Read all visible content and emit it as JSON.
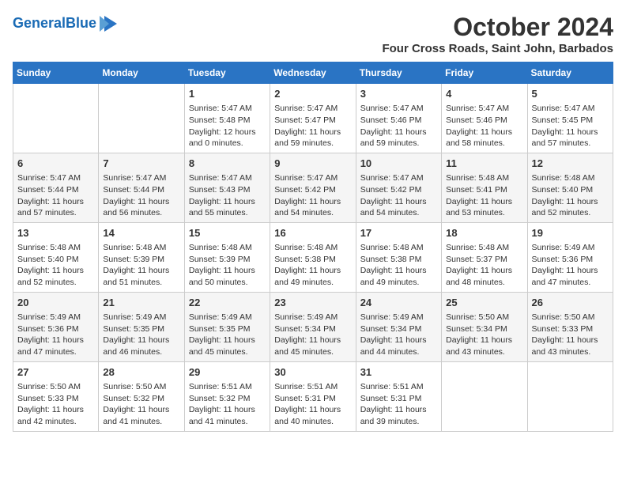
{
  "logo": {
    "text_general": "General",
    "text_blue": "Blue"
  },
  "header": {
    "month": "October 2024",
    "location": "Four Cross Roads, Saint John, Barbados"
  },
  "days_of_week": [
    "Sunday",
    "Monday",
    "Tuesday",
    "Wednesday",
    "Thursday",
    "Friday",
    "Saturday"
  ],
  "weeks": [
    [
      {
        "day": "",
        "content": ""
      },
      {
        "day": "",
        "content": ""
      },
      {
        "day": "1",
        "content": "Sunrise: 5:47 AM\nSunset: 5:48 PM\nDaylight: 12 hours and 0 minutes."
      },
      {
        "day": "2",
        "content": "Sunrise: 5:47 AM\nSunset: 5:47 PM\nDaylight: 11 hours and 59 minutes."
      },
      {
        "day": "3",
        "content": "Sunrise: 5:47 AM\nSunset: 5:46 PM\nDaylight: 11 hours and 59 minutes."
      },
      {
        "day": "4",
        "content": "Sunrise: 5:47 AM\nSunset: 5:46 PM\nDaylight: 11 hours and 58 minutes."
      },
      {
        "day": "5",
        "content": "Sunrise: 5:47 AM\nSunset: 5:45 PM\nDaylight: 11 hours and 57 minutes."
      }
    ],
    [
      {
        "day": "6",
        "content": "Sunrise: 5:47 AM\nSunset: 5:44 PM\nDaylight: 11 hours and 57 minutes."
      },
      {
        "day": "7",
        "content": "Sunrise: 5:47 AM\nSunset: 5:44 PM\nDaylight: 11 hours and 56 minutes."
      },
      {
        "day": "8",
        "content": "Sunrise: 5:47 AM\nSunset: 5:43 PM\nDaylight: 11 hours and 55 minutes."
      },
      {
        "day": "9",
        "content": "Sunrise: 5:47 AM\nSunset: 5:42 PM\nDaylight: 11 hours and 54 minutes."
      },
      {
        "day": "10",
        "content": "Sunrise: 5:47 AM\nSunset: 5:42 PM\nDaylight: 11 hours and 54 minutes."
      },
      {
        "day": "11",
        "content": "Sunrise: 5:48 AM\nSunset: 5:41 PM\nDaylight: 11 hours and 53 minutes."
      },
      {
        "day": "12",
        "content": "Sunrise: 5:48 AM\nSunset: 5:40 PM\nDaylight: 11 hours and 52 minutes."
      }
    ],
    [
      {
        "day": "13",
        "content": "Sunrise: 5:48 AM\nSunset: 5:40 PM\nDaylight: 11 hours and 52 minutes."
      },
      {
        "day": "14",
        "content": "Sunrise: 5:48 AM\nSunset: 5:39 PM\nDaylight: 11 hours and 51 minutes."
      },
      {
        "day": "15",
        "content": "Sunrise: 5:48 AM\nSunset: 5:39 PM\nDaylight: 11 hours and 50 minutes."
      },
      {
        "day": "16",
        "content": "Sunrise: 5:48 AM\nSunset: 5:38 PM\nDaylight: 11 hours and 49 minutes."
      },
      {
        "day": "17",
        "content": "Sunrise: 5:48 AM\nSunset: 5:38 PM\nDaylight: 11 hours and 49 minutes."
      },
      {
        "day": "18",
        "content": "Sunrise: 5:48 AM\nSunset: 5:37 PM\nDaylight: 11 hours and 48 minutes."
      },
      {
        "day": "19",
        "content": "Sunrise: 5:49 AM\nSunset: 5:36 PM\nDaylight: 11 hours and 47 minutes."
      }
    ],
    [
      {
        "day": "20",
        "content": "Sunrise: 5:49 AM\nSunset: 5:36 PM\nDaylight: 11 hours and 47 minutes."
      },
      {
        "day": "21",
        "content": "Sunrise: 5:49 AM\nSunset: 5:35 PM\nDaylight: 11 hours and 46 minutes."
      },
      {
        "day": "22",
        "content": "Sunrise: 5:49 AM\nSunset: 5:35 PM\nDaylight: 11 hours and 45 minutes."
      },
      {
        "day": "23",
        "content": "Sunrise: 5:49 AM\nSunset: 5:34 PM\nDaylight: 11 hours and 45 minutes."
      },
      {
        "day": "24",
        "content": "Sunrise: 5:49 AM\nSunset: 5:34 PM\nDaylight: 11 hours and 44 minutes."
      },
      {
        "day": "25",
        "content": "Sunrise: 5:50 AM\nSunset: 5:34 PM\nDaylight: 11 hours and 43 minutes."
      },
      {
        "day": "26",
        "content": "Sunrise: 5:50 AM\nSunset: 5:33 PM\nDaylight: 11 hours and 43 minutes."
      }
    ],
    [
      {
        "day": "27",
        "content": "Sunrise: 5:50 AM\nSunset: 5:33 PM\nDaylight: 11 hours and 42 minutes."
      },
      {
        "day": "28",
        "content": "Sunrise: 5:50 AM\nSunset: 5:32 PM\nDaylight: 11 hours and 41 minutes."
      },
      {
        "day": "29",
        "content": "Sunrise: 5:51 AM\nSunset: 5:32 PM\nDaylight: 11 hours and 41 minutes."
      },
      {
        "day": "30",
        "content": "Sunrise: 5:51 AM\nSunset: 5:31 PM\nDaylight: 11 hours and 40 minutes."
      },
      {
        "day": "31",
        "content": "Sunrise: 5:51 AM\nSunset: 5:31 PM\nDaylight: 11 hours and 39 minutes."
      },
      {
        "day": "",
        "content": ""
      },
      {
        "day": "",
        "content": ""
      }
    ]
  ]
}
